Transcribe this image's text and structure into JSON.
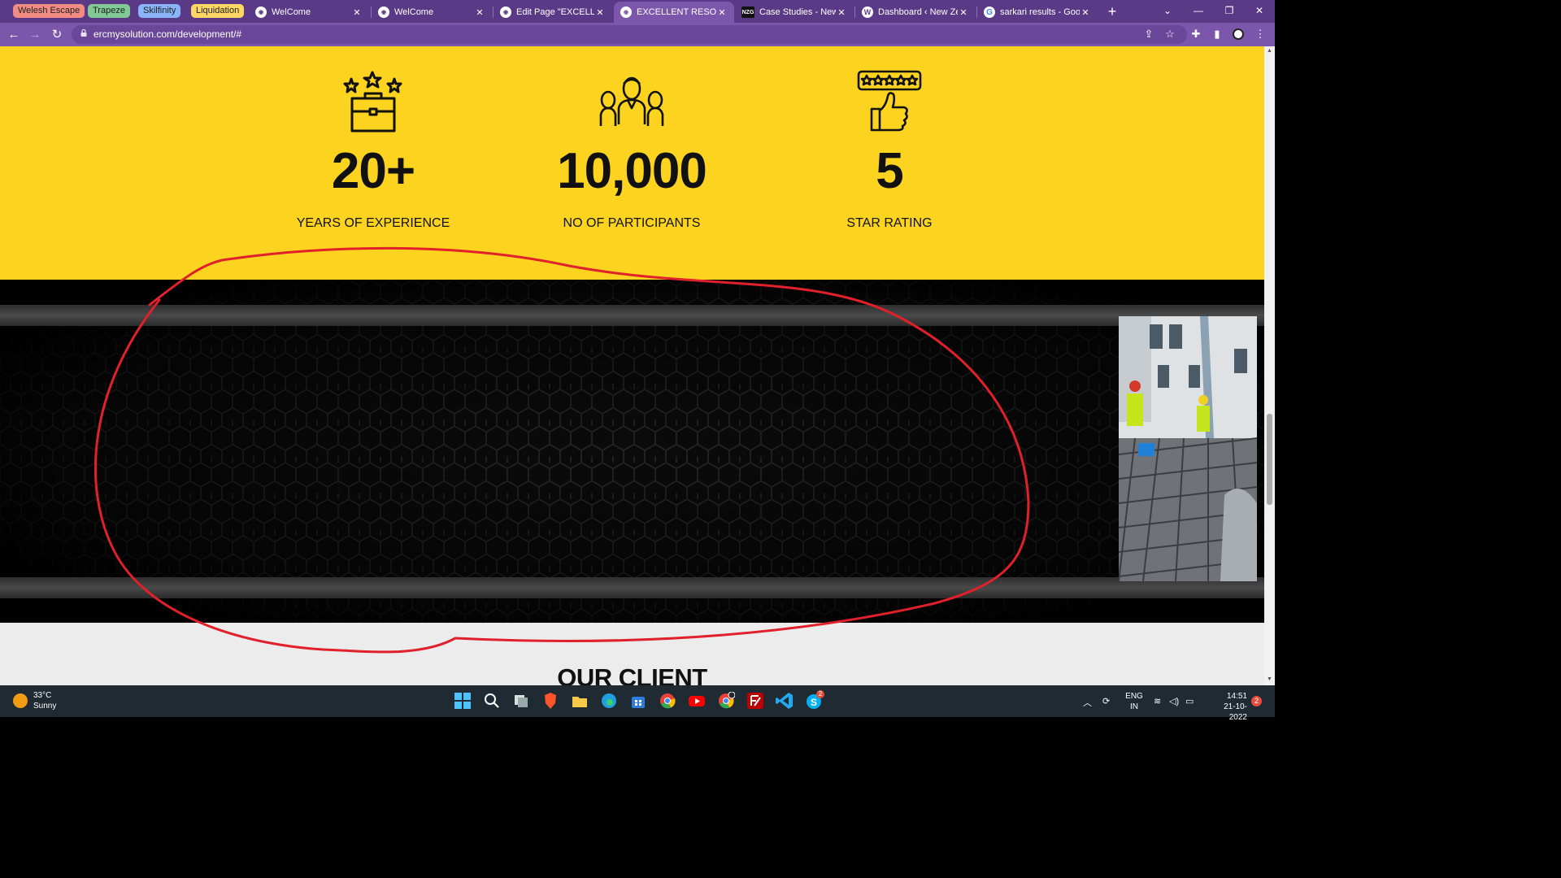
{
  "browser": {
    "tab_groups": [
      {
        "label": "Welesh Escape",
        "color": "#f28b82"
      },
      {
        "label": "Trapeze",
        "color": "#81c995"
      },
      {
        "label": "Skilfinity",
        "color": "#8ab4f8"
      },
      {
        "label": "Liquidation",
        "color": "#fdd663"
      }
    ],
    "tabs": [
      {
        "title": "WelCome",
        "icon": "globe-icon"
      },
      {
        "title": "WelCome",
        "icon": "globe-icon"
      },
      {
        "title": "Edit Page \"EXCELLENT",
        "icon": "globe-icon"
      },
      {
        "title": "EXCELLENT RESOURCE",
        "icon": "globe-icon",
        "active": true
      },
      {
        "title": "Case Studies - New Ze",
        "icon": "nzg-icon"
      },
      {
        "title": "Dashboard ‹ New Zeal",
        "icon": "wordpress-icon"
      },
      {
        "title": "sarkari results - Goog",
        "icon": "google-icon"
      }
    ],
    "url": "ercmysolution.com/development/#"
  },
  "page": {
    "stats": [
      {
        "value": "20+",
        "label": "YEARS OF EXPERIENCE",
        "icon": "briefcase-stars-icon"
      },
      {
        "value": "10,000",
        "label": "NO OF PARTICIPANTS",
        "icon": "people-group-icon"
      },
      {
        "value": "5",
        "label": "STAR RATING",
        "icon": "thumbs-up-rating-icon"
      }
    ],
    "clients_heading": "OUR CLIENT",
    "colors": {
      "stats_bg": "#fcd41f",
      "banner_bg": "#000000",
      "annotation": "#e0202a"
    }
  },
  "taskbar": {
    "weather": {
      "temp": "33°C",
      "condition": "Sunny"
    },
    "apps": [
      "windows-start-icon",
      "search-icon",
      "task-view-icon",
      "brave-icon",
      "file-explorer-icon",
      "edge-icon",
      "store-icon",
      "chrome-icon",
      "youtube-icon",
      "chrome-profile-icon",
      "filezilla-icon",
      "vscode-icon",
      "skype-icon"
    ],
    "skype_badge": "2",
    "lang_top": "ENG",
    "lang_bottom": "IN",
    "time": "14:51",
    "date": "21-10-2022",
    "notifications": "2"
  }
}
